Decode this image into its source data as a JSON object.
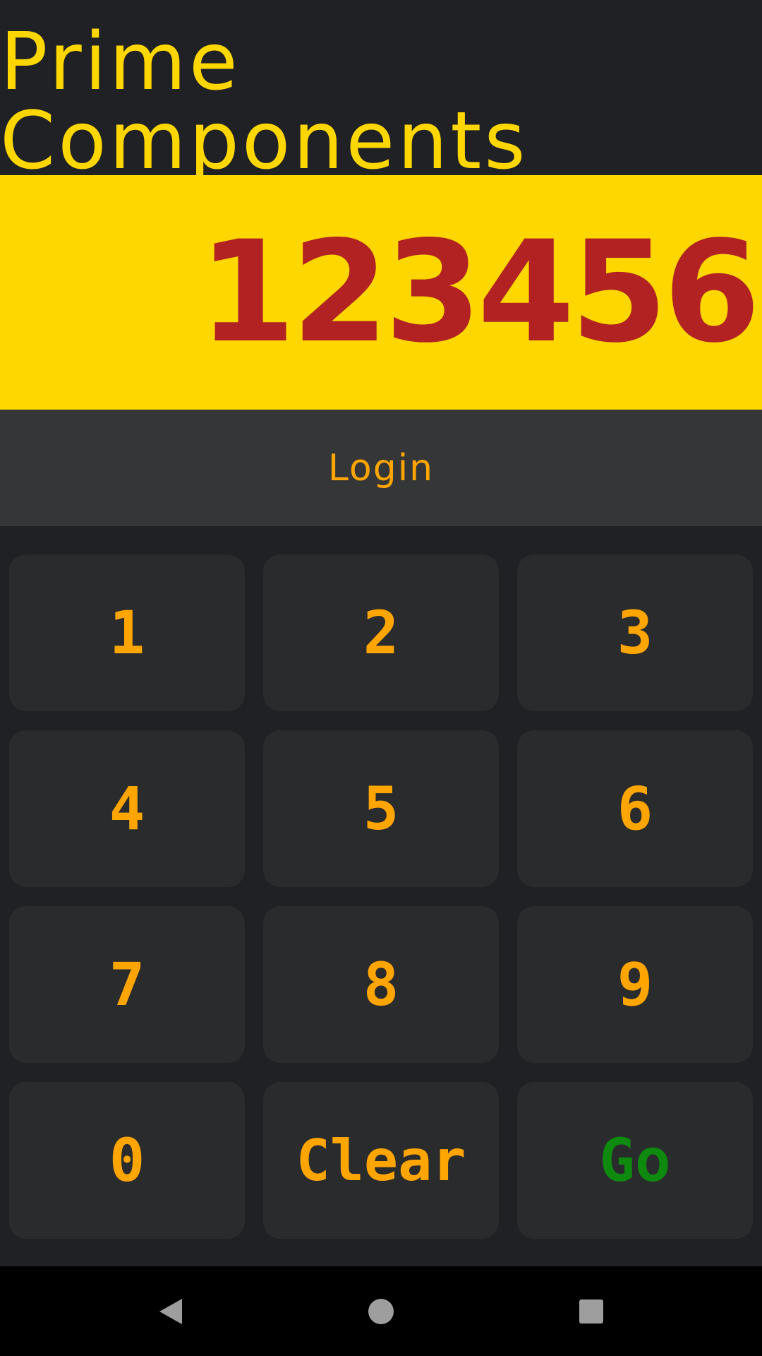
{
  "app": {
    "title": "Prime Components"
  },
  "display": {
    "value": "123456"
  },
  "login": {
    "label": "Login"
  },
  "keypad": {
    "keys": [
      {
        "label": "1"
      },
      {
        "label": "2"
      },
      {
        "label": "3"
      },
      {
        "label": "4"
      },
      {
        "label": "5"
      },
      {
        "label": "6"
      },
      {
        "label": "7"
      },
      {
        "label": "8"
      },
      {
        "label": "9"
      },
      {
        "label": "0"
      },
      {
        "label": "Clear"
      },
      {
        "label": "Go"
      }
    ]
  },
  "colors": {
    "background": "#202124",
    "title": "#FFD700",
    "display_background": "#FFD700",
    "display_text": "#B22222",
    "login_bar": "#353638",
    "key_background": "#2A2B2D",
    "key_text": "#FFA500",
    "go_text": "#0E8A0E"
  },
  "navbar": {
    "icons": [
      "back-icon",
      "home-icon",
      "recents-icon"
    ]
  }
}
